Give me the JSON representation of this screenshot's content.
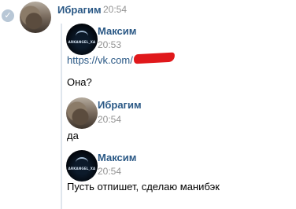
{
  "messages": [
    {
      "author": "Ибрагим",
      "time": "20:54",
      "avatar": "ibragim-photo"
    },
    {
      "author": "Максим",
      "time": "20:53",
      "avatar": "arkangel-logo",
      "avatar_text": "ARKANGEL_XA",
      "link": "https://vk.com/",
      "text": "Она?"
    },
    {
      "author": "Ибрагим",
      "time": "20:54",
      "avatar": "ibragim-photo",
      "text": "да"
    },
    {
      "author": "Максим",
      "time": "20:54",
      "avatar": "arkangel-logo",
      "avatar_text": "ARKANGEL_XA",
      "text": "Пусть отпишет, сделаю манибэк"
    }
  ],
  "icons": {
    "status": "check-icon"
  },
  "colors": {
    "name": "#2a5885",
    "time": "#939393",
    "link": "#2a5885",
    "redaction": "#e0181b"
  }
}
